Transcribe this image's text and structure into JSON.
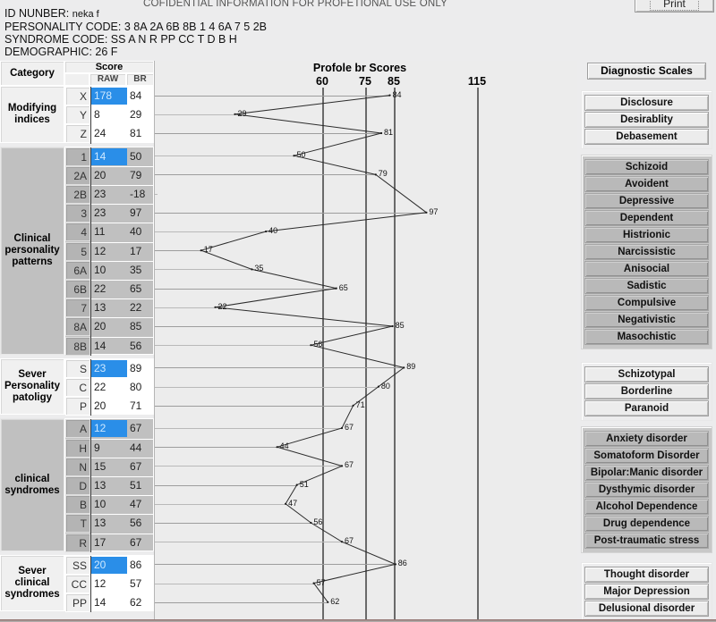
{
  "header": {
    "confidential_title": "COFIDENTIAL INFORMATION FOR PROFETIONAL USE ONLY",
    "print_label": "Print",
    "id_label": "ID NUNBER:",
    "id_value": "neka f",
    "personality_label": "PERSONALITY CODE:",
    "personality_value": "3 8A 2A 6B 8B 1 4 6A 7 5 2B",
    "syndrome_label": "SYNDROME CODE:",
    "syndrome_value": "SS A N R PP CC T D B H",
    "demographic_label": "DEMOGRAPHIC:",
    "demographic_value": "26          F"
  },
  "table": {
    "category_header": "Category",
    "score_header": "Score",
    "raw_header": "RAW",
    "br_header": "BR",
    "groups": [
      {
        "category": "Modifying\nindices",
        "shade": "white",
        "rows": [
          {
            "code": "X",
            "raw": "178",
            "br": "84",
            "selected": true
          },
          {
            "code": "Y",
            "raw": "8",
            "br": "29",
            "selected": false
          },
          {
            "code": "Z",
            "raw": "24",
            "br": "81",
            "selected": false
          }
        ]
      },
      {
        "category": "Clinical\npersonality\npatterns",
        "shade": "gray",
        "rows": [
          {
            "code": "1",
            "raw": "14",
            "br": "50",
            "selected": true
          },
          {
            "code": "2A",
            "raw": "20",
            "br": "79",
            "selected": false
          },
          {
            "code": "2B",
            "raw": "23",
            "br": "-18",
            "selected": false
          },
          {
            "code": "3",
            "raw": "23",
            "br": "97",
            "selected": false
          },
          {
            "code": "4",
            "raw": "11",
            "br": "40",
            "selected": false
          },
          {
            "code": "5",
            "raw": "12",
            "br": "17",
            "selected": false
          },
          {
            "code": "6A",
            "raw": "10",
            "br": "35",
            "selected": false
          },
          {
            "code": "6B",
            "raw": "22",
            "br": "65",
            "selected": false
          },
          {
            "code": "7",
            "raw": "13",
            "br": "22",
            "selected": false
          },
          {
            "code": "8A",
            "raw": "20",
            "br": "85",
            "selected": false
          },
          {
            "code": "8B",
            "raw": "14",
            "br": "56",
            "selected": false
          }
        ]
      },
      {
        "category": "Sever\nPersonality\npatoligy",
        "shade": "white",
        "rows": [
          {
            "code": "S",
            "raw": "23",
            "br": "89",
            "selected": true
          },
          {
            "code": "C",
            "raw": "22",
            "br": "80",
            "selected": false
          },
          {
            "code": "P",
            "raw": "20",
            "br": "71",
            "selected": false
          }
        ]
      },
      {
        "category": "clinical\nsyndromes",
        "shade": "gray",
        "rows": [
          {
            "code": "A",
            "raw": "12",
            "br": "67",
            "selected": true
          },
          {
            "code": "H",
            "raw": "9",
            "br": "44",
            "selected": false
          },
          {
            "code": "N",
            "raw": "15",
            "br": "67",
            "selected": false
          },
          {
            "code": "D",
            "raw": "13",
            "br": "51",
            "selected": false
          },
          {
            "code": "B",
            "raw": "10",
            "br": "47",
            "selected": false
          },
          {
            "code": "T",
            "raw": "13",
            "br": "56",
            "selected": false
          },
          {
            "code": "R",
            "raw": "17",
            "br": "67",
            "selected": false
          }
        ]
      },
      {
        "category": "Sever\nclinical\nsyndromes",
        "shade": "white",
        "rows": [
          {
            "code": "SS",
            "raw": "20",
            "br": "86",
            "selected": true
          },
          {
            "code": "CC",
            "raw": "12",
            "br": "57",
            "selected": false
          },
          {
            "code": "PP",
            "raw": "14",
            "br": "62",
            "selected": false
          }
        ]
      }
    ]
  },
  "chart_data": {
    "type": "line",
    "title": "Profole br Scores",
    "xlabel": "",
    "ylabel": "",
    "xticks": [
      60,
      75,
      85,
      115
    ],
    "xtick_labels": [
      "60",
      "75",
      "85",
      "115"
    ],
    "xlim": [
      0,
      130
    ],
    "grid": true,
    "orientation": "horizontal",
    "categories": [
      "X",
      "Y",
      "Z",
      "1",
      "2A",
      "2B",
      "3",
      "4",
      "5",
      "6A",
      "6B",
      "7",
      "8A",
      "8B",
      "S",
      "C",
      "P",
      "A",
      "H",
      "N",
      "D",
      "B",
      "T",
      "R",
      "SS",
      "CC",
      "PP"
    ],
    "values": [
      84,
      29,
      81,
      50,
      79,
      -18,
      97,
      40,
      17,
      35,
      65,
      22,
      85,
      56,
      89,
      80,
      71,
      67,
      44,
      67,
      51,
      47,
      56,
      67,
      86,
      57,
      62
    ],
    "point_labels": [
      "84",
      "29",
      "81",
      "50",
      "79",
      "",
      "97",
      "40",
      "17",
      "35",
      "65",
      "22",
      "85",
      "56",
      "89",
      "80",
      "71",
      "67",
      "44",
      "67",
      "51",
      "47",
      "56",
      "67",
      "86",
      "57",
      "62"
    ]
  },
  "scales_panel": {
    "diagnostic_scales_label": "Diagnostic Scales",
    "groups": [
      {
        "shade": "light",
        "buttons": [
          "Disclosure",
          "Desirablity",
          "Debasement"
        ]
      },
      {
        "shade": "gray",
        "buttons": [
          "Schizoid",
          "Avoident",
          "Depressive",
          "Dependent",
          "Histrionic",
          "Narcissistic",
          "Anisocial",
          "Sadistic",
          "Compulsive",
          "Negativistic",
          "Masochistic"
        ]
      },
      {
        "shade": "light",
        "buttons": [
          "Schizotypal",
          "Borderline",
          "Paranoid"
        ]
      },
      {
        "shade": "gray",
        "buttons": [
          "Anxiety disorder",
          "Somatoform Disorder",
          "Bipolar:Manic disorder",
          "Dysthymic disorder",
          "Alcohol Dependence",
          "Drug dependence",
          "Post-traumatic stress"
        ]
      },
      {
        "shade": "light",
        "buttons": [
          "Thought disorder",
          "Major Depression",
          "Delusional disorder"
        ]
      }
    ]
  },
  "colors": {
    "selection": "#2a8ee8",
    "panel_gray": "#c0c0c0",
    "background": "#ececed",
    "axis": "#6a6a6a"
  }
}
